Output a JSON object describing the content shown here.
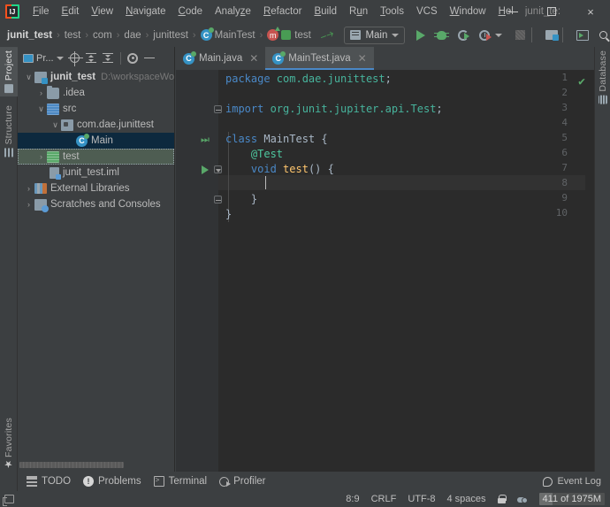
{
  "window": {
    "title": "junit_te:",
    "minimize_label": "minimize",
    "maximize_label": "maximize",
    "close_label": "×"
  },
  "menubar": {
    "items": [
      {
        "label": "File",
        "mnemonic": "F"
      },
      {
        "label": "Edit",
        "mnemonic": "E"
      },
      {
        "label": "View",
        "mnemonic": "V"
      },
      {
        "label": "Navigate",
        "mnemonic": "N"
      },
      {
        "label": "Code",
        "mnemonic": "C"
      },
      {
        "label": "Analyze",
        "mnemonic": "z"
      },
      {
        "label": "Refactor",
        "mnemonic": "R"
      },
      {
        "label": "Build",
        "mnemonic": "B"
      },
      {
        "label": "Run",
        "mnemonic": "u"
      },
      {
        "label": "Tools",
        "mnemonic": "T"
      },
      {
        "label": "VCS",
        "mnemonic": ""
      },
      {
        "label": "Window",
        "mnemonic": "W"
      },
      {
        "label": "Hel",
        "mnemonic": "H"
      }
    ]
  },
  "breadcrumbs": {
    "items": [
      {
        "label": "junit_test",
        "icon": "none",
        "bold": true
      },
      {
        "label": "test",
        "icon": "none",
        "bold": false
      },
      {
        "label": "com",
        "icon": "none",
        "bold": false
      },
      {
        "label": "dae",
        "icon": "none",
        "bold": false
      },
      {
        "label": "junittest",
        "icon": "none",
        "bold": false
      },
      {
        "label": "MainTest",
        "icon": "class-icon",
        "bold": false
      },
      {
        "label": "test",
        "icon": "method-icon",
        "bold": false
      }
    ],
    "separator": "›"
  },
  "toolbar": {
    "build_label": "build-hammer-icon",
    "run_config": {
      "label": "Main",
      "dropdown": "▼"
    },
    "buttons": [
      {
        "name": "run-button",
        "label": "Run"
      },
      {
        "name": "debug-button",
        "label": "Debug"
      },
      {
        "name": "run-coverage-button",
        "label": "Run with Coverage"
      },
      {
        "name": "profiler-button",
        "label": "Profiler"
      },
      {
        "name": "stop-button",
        "label": "Stop"
      },
      {
        "name": "project-structure-button",
        "label": "Project Structure"
      },
      {
        "name": "updates-button",
        "label": "Updates"
      },
      {
        "name": "search-everywhere-button",
        "label": "Search Everywhere"
      }
    ]
  },
  "left_stripe": {
    "top": [
      {
        "label": "Project",
        "icon": "project-icon",
        "active": true
      },
      {
        "label": "Structure",
        "icon": "structure-icon",
        "active": false
      }
    ],
    "bottom": [
      {
        "label": "Favorites",
        "icon": "star-icon",
        "active": false
      }
    ]
  },
  "right_stripe": {
    "items": [
      {
        "label": "Database",
        "icon": "database-icon",
        "active": false
      }
    ]
  },
  "project_panel": {
    "title": "Pr...",
    "toolbar_buttons": [
      {
        "name": "select-opened-file-button",
        "label": "Select Opened File"
      },
      {
        "name": "expand-all-button",
        "label": "Expand All"
      },
      {
        "name": "collapse-all-button",
        "label": "Collapse All"
      },
      {
        "name": "settings-button",
        "label": "Settings"
      },
      {
        "name": "hide-button",
        "label": "Hide"
      }
    ],
    "tree": [
      {
        "label": "junit_test",
        "path": "D:\\workspaceWo",
        "indent": 0,
        "arrow": "∨",
        "icon": "module-icon",
        "bold": true,
        "state": "normal"
      },
      {
        "label": ".idea",
        "path": "",
        "indent": 1,
        "arrow": "›",
        "icon": "folder-icon",
        "bold": false,
        "state": "normal"
      },
      {
        "label": "src",
        "path": "",
        "indent": 1,
        "arrow": "∨",
        "icon": "source-root-icon",
        "bold": false,
        "state": "normal"
      },
      {
        "label": "com.dae.junittest",
        "path": "",
        "indent": 2,
        "arrow": "∨",
        "icon": "package-icon",
        "bold": false,
        "state": "normal"
      },
      {
        "label": "Main",
        "path": "",
        "indent": 3,
        "arrow": "",
        "icon": "java-class-runnable-icon",
        "bold": false,
        "state": "selected"
      },
      {
        "label": "test",
        "path": "",
        "indent": 1,
        "arrow": "›",
        "icon": "test-root-icon",
        "bold": false,
        "state": "focused"
      },
      {
        "label": "junit_test.iml",
        "path": "",
        "indent": 2,
        "arrow": "",
        "icon": "iml-icon",
        "bold": false,
        "state": "normal"
      },
      {
        "label": "External Libraries",
        "path": "",
        "indent": 0,
        "arrow": "›",
        "icon": "libraries-icon",
        "bold": false,
        "state": "normal"
      },
      {
        "label": "Scratches and Consoles",
        "path": "",
        "indent": 0,
        "arrow": "›",
        "icon": "scratches-icon",
        "bold": false,
        "state": "normal"
      }
    ]
  },
  "editor": {
    "tabs": [
      {
        "label": "Main.java",
        "active": false,
        "close": "✕"
      },
      {
        "label": "MainTest.java",
        "active": true,
        "close": "✕"
      }
    ],
    "inspection_status": "✔",
    "lines": [
      {
        "num": "1",
        "gutter": "",
        "fold": "",
        "cursor": false,
        "tokens": [
          {
            "t": "package ",
            "c": "kw"
          },
          {
            "t": "com.dae.junittest",
            "c": "pkg"
          },
          {
            "t": ";",
            "c": "cls"
          }
        ]
      },
      {
        "num": "2",
        "gutter": "",
        "fold": "",
        "cursor": false,
        "tokens": []
      },
      {
        "num": "3",
        "gutter": "",
        "fold": "",
        "cursor": false,
        "tokens": [
          {
            "t": "import ",
            "c": "kw"
          },
          {
            "t": "org.junit.jupiter.api",
            "c": "pkg"
          },
          {
            "t": ".",
            "c": "pkg"
          },
          {
            "t": "Test",
            "c": "pkg"
          },
          {
            "t": ";",
            "c": "cls"
          }
        ]
      },
      {
        "num": "4",
        "gutter": "",
        "fold": "",
        "cursor": false,
        "tokens": []
      },
      {
        "num": "5",
        "gutter": "run-all",
        "fold": "",
        "cursor": false,
        "tokens": [
          {
            "t": "class ",
            "c": "kw"
          },
          {
            "t": "MainTest ",
            "c": "cls"
          },
          {
            "t": "{",
            "c": "cls"
          }
        ]
      },
      {
        "num": "6",
        "gutter": "",
        "fold": "",
        "cursor": false,
        "tokens": [
          {
            "t": "    ",
            "c": "cls"
          },
          {
            "t": "@Test",
            "c": "anno"
          }
        ]
      },
      {
        "num": "7",
        "gutter": "run",
        "fold": "down",
        "cursor": false,
        "tokens": [
          {
            "t": "    ",
            "c": "cls"
          },
          {
            "t": "void ",
            "c": "kw"
          },
          {
            "t": "test",
            "c": "mth"
          },
          {
            "t": "() {",
            "c": "cls"
          }
        ]
      },
      {
        "num": "8",
        "gutter": "",
        "fold": "",
        "cursor": true,
        "tokens": []
      },
      {
        "num": "9",
        "gutter": "",
        "fold": "up",
        "cursor": false,
        "tokens": [
          {
            "t": "    }",
            "c": "cls"
          }
        ]
      },
      {
        "num": "10",
        "gutter": "",
        "fold": "",
        "cursor": false,
        "tokens": [
          {
            "t": "}",
            "c": "cls"
          }
        ]
      }
    ]
  },
  "bottom_bar": {
    "windows": [
      {
        "label": "TODO",
        "icon": "todo-icon"
      },
      {
        "label": "Problems",
        "icon": "problems-icon"
      },
      {
        "label": "Terminal",
        "icon": "terminal-icon"
      },
      {
        "label": "Profiler",
        "icon": "profiler-icon"
      }
    ],
    "event_log": {
      "label": "Event Log",
      "icon": "event-log-icon"
    }
  },
  "status_bar": {
    "caret_position": "8:9",
    "line_separator": "CRLF",
    "encoding": "UTF-8",
    "indent": "4 spaces",
    "lock_icon": "unlocked-icon",
    "vcs_icon": "cloud-icon",
    "memory": "411 of 1975M"
  },
  "colors": {
    "accent_blue": "#4A88C7",
    "selection": "#0D293E",
    "green": "#59A869",
    "editor_bg": "#2B2B2B",
    "chrome_bg": "#3C3F41"
  }
}
